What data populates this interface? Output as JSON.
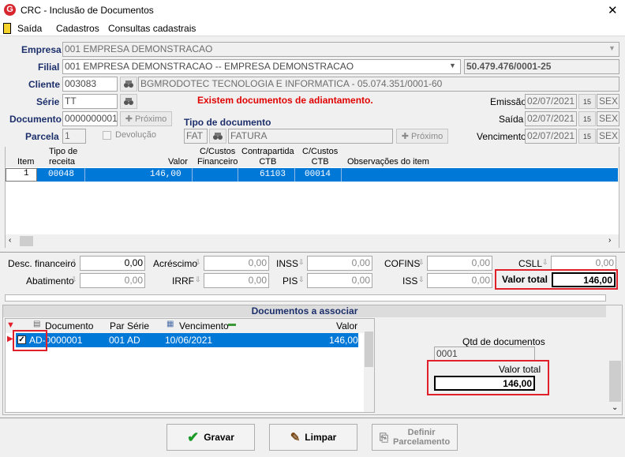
{
  "window": {
    "title": "CRC - Inclusão de Documentos",
    "close": "✕"
  },
  "menu": [
    "Saída",
    "Cadastros",
    "Consultas cadastrais"
  ],
  "form": {
    "empresa_label": "Empresa",
    "empresa_value": "001 EMPRESA DEMONSTRACAO",
    "filial_label": "Filial",
    "filial_value": "001 EMPRESA DEMONSTRACAO -- EMPRESA DEMONSTRACAO",
    "cnpj": "50.479.476/0001-25",
    "cliente_label": "Cliente",
    "cliente_code": "003083",
    "cliente_name": "BGMRODOTEC TECNOLOGIA  E INFORMATICA - 05.074.351/0001-60",
    "serie_label": "Série",
    "serie_value": "TT",
    "aviso": "Existem documentos de adiantamento.",
    "documento_label": "Documento",
    "documento_value": "0000000001",
    "proximo": "Próximo",
    "tipo_doc_label": "Tipo de documento",
    "tipo_doc_code": "FAT",
    "tipo_doc_name": "FATURA",
    "parcela_label": "Parcela",
    "parcela_value": "1",
    "devolucao": "Devolução",
    "emissao_label": "Emissão",
    "emissao_value": "02/07/2021",
    "emissao_dia": "SEX",
    "saida_label": "Saída",
    "saida_value": "02/07/2021",
    "saida_dia": "SEX",
    "vencimento_label": "Vencimento",
    "vencimento_value": "02/07/2021",
    "vencimento_dia": "SEX",
    "cal_icon": "15"
  },
  "items_table": {
    "headers": {
      "item": "Item",
      "tipo": "Tipo de\nreceita",
      "valor": "Valor",
      "cc_fin": "C/Custos\nFinanceiro",
      "contrapartida": "Contrapartida\nCTB",
      "cc_ctb": "C/Custos\nCTB",
      "obs": "Observações do item"
    },
    "row": {
      "item": "1",
      "tipo": "00048",
      "valor": "146,00",
      "cc_fin": "",
      "contrapartida": "61103",
      "cc_ctb": "00014",
      "obs": ""
    }
  },
  "totals": {
    "desc_fin_label": "Desc. financeiro",
    "desc_fin": "0,00",
    "acrescimo_label": "Acréscimo",
    "acrescimo": "0,00",
    "inss_label": "INSS",
    "inss": "0,00",
    "cofins_label": "COFINS",
    "cofins": "0,00",
    "csll_label": "CSLL",
    "csll": "0,00",
    "abatimento_label": "Abatimento",
    "abatimento": "0,00",
    "irrf_label": "IRRF",
    "irrf": "0,00",
    "pis_label": "PIS",
    "pis": "0,00",
    "iss_label": "ISS",
    "iss": "0,00",
    "valor_total_label": "Valor total",
    "valor_total": "146,00"
  },
  "assoc": {
    "title": "Documentos a associar",
    "headers": {
      "documento": "Documento",
      "par": "Par",
      "serie": "Série",
      "vencimento": "Vencimento",
      "valor": "Valor"
    },
    "row": {
      "documento": "AD-0000001",
      "par": "001",
      "serie": "AD",
      "vencimento": "10/06/2021",
      "valor": "146,00"
    },
    "qtd_label": "Qtd de documentos",
    "qtd_value": "0001",
    "valor_total_label": "Valor total",
    "valor_total_value": "146,00"
  },
  "buttons": {
    "gravar": "Gravar",
    "limpar": "Limpar",
    "definir": "Definir\nParcelamento"
  },
  "colors": {
    "selection": "#0078d7",
    "highlight": "#e0202a",
    "label": "#1c2f6b",
    "warning": "#e00000"
  }
}
